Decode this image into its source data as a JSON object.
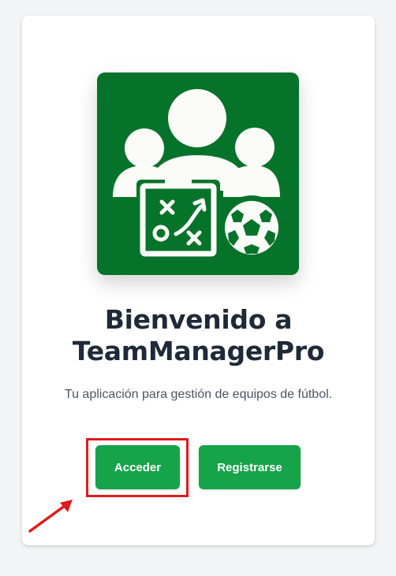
{
  "app": {
    "welcome_line1": "Bienvenido a",
    "welcome_line2": "TeamManagerPro",
    "subtitle": "Tu aplicación para gestión de equipos de fútbol."
  },
  "actions": {
    "login_label": "Acceder",
    "register_label": "Registrarse"
  },
  "logo": {
    "icon": "team-tactics-soccer-icon",
    "background": "#06732a",
    "foreground": "#fbfbf7"
  },
  "colors": {
    "primary_button": "#16a34a",
    "annotation": "#e01b1b",
    "title_text": "#1f2937"
  }
}
